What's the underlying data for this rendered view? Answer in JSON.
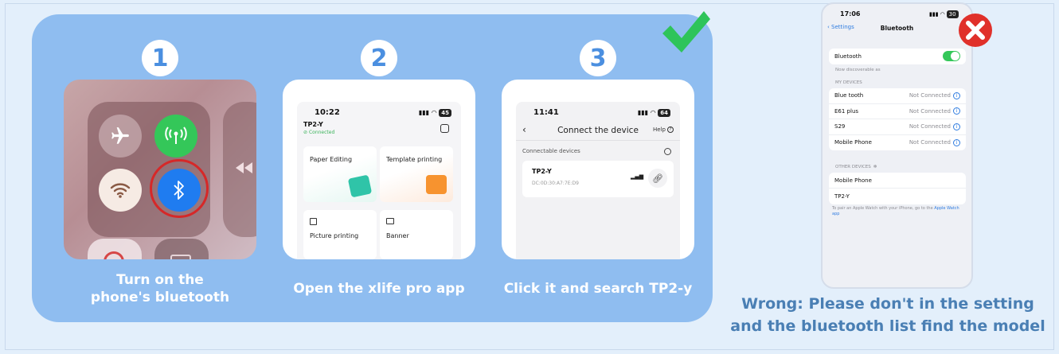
{
  "steps": [
    {
      "number": "1",
      "caption_line1": "Turn on the",
      "caption_line2": "phone's bluetooth"
    },
    {
      "number": "2",
      "caption": "Open the xlife pro app"
    },
    {
      "number": "3",
      "caption": "Click it and search TP2-y"
    }
  ],
  "app_screen": {
    "time": "10:22",
    "battery": "45",
    "device_name": "TP2-Y",
    "device_status": "Connected",
    "tiles": [
      "Paper Editing",
      "Template printing",
      "Picture printing",
      "Banner"
    ]
  },
  "connect_screen": {
    "time": "11:41",
    "battery": "64",
    "title": "Connect the device",
    "help_label": "Help",
    "section_label": "Connectable devices",
    "device_name": "TP2-Y",
    "device_mac": "DC:0D:30:A7:7E:D9"
  },
  "settings_screen": {
    "time": "17:06",
    "battery": "30",
    "back_label": "Settings",
    "title": "Bluetooth",
    "bluetooth_label": "Bluetooth",
    "discoverable_note": "Now discoverable as",
    "my_devices_header": "MY DEVICES",
    "my_devices": [
      {
        "name": "Blue tooth",
        "status": "Not Connected"
      },
      {
        "name": "E61 plus",
        "status": "Not Connected"
      },
      {
        "name": "S29",
        "status": "Not Connected"
      },
      {
        "name": "Mobile Phone",
        "status": "Not Connected"
      }
    ],
    "other_devices_header": "OTHER DEVICES",
    "other_devices": [
      "Mobile Phone",
      "TP2-Y"
    ],
    "footer_note": "To pair an Apple Watch with your iPhone, go to the",
    "footer_link": "Apple Watch app"
  },
  "wrong_caption_line1": "Wrong: Please don't in the setting",
  "wrong_caption_line2": "and the bluetooth list find the model",
  "colors": {
    "panel": "#8fbdf0",
    "check": "#2ec45a",
    "x_mark": "#e0302a",
    "bluetooth_on": "#1f7cf0",
    "cellular_on": "#34c759",
    "ring": "#d62828"
  }
}
